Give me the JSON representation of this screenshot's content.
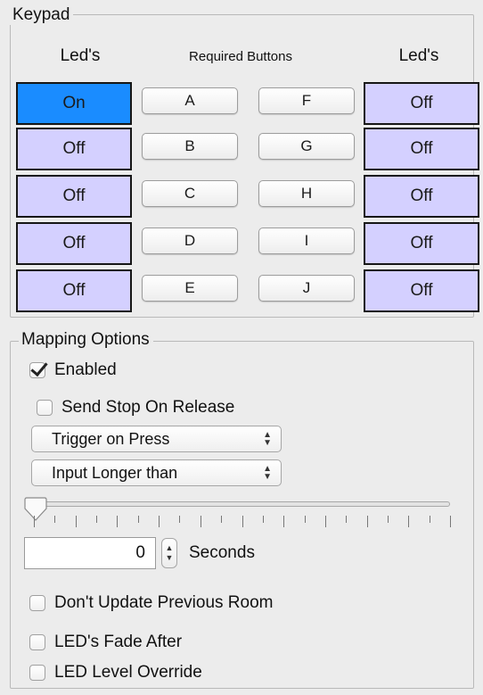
{
  "keypad": {
    "title": "Keypad",
    "left_header": "Led's",
    "center_header": "Required Buttons",
    "right_header": "Led's",
    "rows": [
      {
        "left_led": "On",
        "left_state": "on",
        "btn1": "A",
        "btn2": "F",
        "right_led": "Off",
        "right_state": "off"
      },
      {
        "left_led": "Off",
        "left_state": "off",
        "btn1": "B",
        "btn2": "G",
        "right_led": "Off",
        "right_state": "off"
      },
      {
        "left_led": "Off",
        "left_state": "off",
        "btn1": "C",
        "btn2": "H",
        "right_led": "Off",
        "right_state": "off"
      },
      {
        "left_led": "Off",
        "left_state": "off",
        "btn1": "D",
        "btn2": "I",
        "right_led": "Off",
        "right_state": "off"
      },
      {
        "left_led": "Off",
        "left_state": "off",
        "btn1": "E",
        "btn2": "J",
        "right_led": "Off",
        "right_state": "off"
      }
    ],
    "colors": {
      "led_on": "#1a8cff",
      "led_off": "#d4d0ff"
    }
  },
  "mapping": {
    "title": "Mapping Options",
    "enabled_label": "Enabled",
    "enabled_checked": true,
    "send_stop_label": "Send Stop On Release",
    "send_stop_checked": false,
    "trigger_select": "Trigger on Press",
    "input_select": "Input Longer than",
    "slider_value": 0,
    "seconds_value": "0",
    "seconds_label": "Seconds",
    "dont_update_label": "Don't Update Previous Room",
    "dont_update_checked": false,
    "fade_after_label": "LED's Fade After",
    "fade_after_checked": false,
    "level_override_label": "LED Level Override",
    "level_override_checked": false
  }
}
